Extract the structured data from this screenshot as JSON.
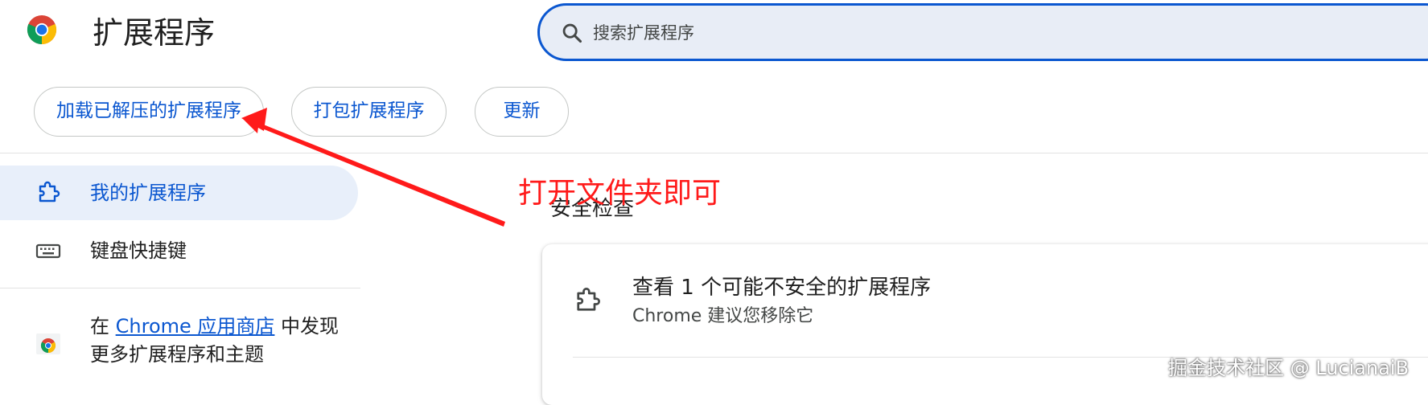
{
  "header": {
    "title": "扩展程序",
    "logo_icon": "chrome-logo-icon",
    "search": {
      "placeholder": "搜索扩展程序",
      "value": "",
      "icon": "search-icon"
    }
  },
  "toolbar": {
    "load_unpacked_label": "加载已解压的扩展程序",
    "pack_label": "打包扩展程序",
    "update_label": "更新"
  },
  "sidebar": {
    "items": [
      {
        "label": "我的扩展程序",
        "icon": "puzzle-icon",
        "active": true
      },
      {
        "label": "键盘快捷键",
        "icon": "keyboard-icon",
        "active": false
      }
    ],
    "webstore": {
      "prefix": "在 ",
      "link": "Chrome 应用商店",
      "suffix_line1": " 中发现",
      "line2": "更多扩展程序和主题",
      "icon": "chrome-webstore-icon"
    }
  },
  "main": {
    "section_title": "安全检查",
    "safety_card": {
      "title": "查看 1 个可能不安全的扩展程序",
      "subtitle": "Chrome 建议您移除它",
      "icon": "puzzle-icon"
    }
  },
  "annotation": {
    "text": "打开文件夹即可",
    "color": "#ff1a1a"
  },
  "watermark": "掘金技术社区 @ LucianaiB",
  "colors": {
    "accent": "#0b57d0",
    "active_nav_bg": "#e8effa",
    "search_bg": "#e8edf6"
  }
}
